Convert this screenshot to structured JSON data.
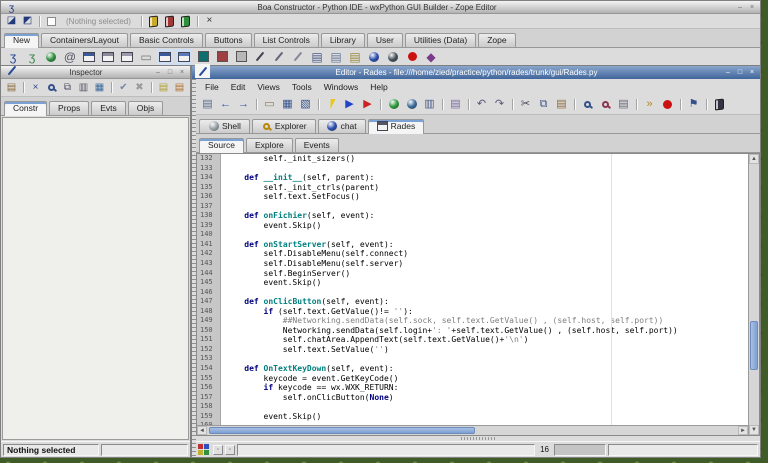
{
  "colors": {
    "desktop_green": "#3f5c28",
    "editor_titlebar_blue": "#40669b",
    "scrollbar_thumb_blue": "#7d9fd2",
    "selected_tab_accent": "#7ba2d4",
    "code_keyword": "#00007f",
    "code_function_name": "#007f7f",
    "code_string": "#7f7f7f",
    "code_comment": "#7f7f7f"
  },
  "main_window": {
    "title": "Boa Constructor - Python IDE - wxPython GUI Builder - Zope Editor",
    "title_icon": [
      {
        "name": "boa-logo-icon",
        "type": "glyph",
        "glyph": "ʒ",
        "color": "#16308a",
        "static": true
      }
    ],
    "window_buttons": [
      {
        "name": "minimize-button",
        "glyph": "–"
      },
      {
        "name": "close-button",
        "glyph": "×"
      }
    ],
    "toolbar": {
      "left_icons": [
        {
          "name": "frame-designer-icon",
          "type": "glyph",
          "glyph": "◪",
          "color": "#223a7a"
        },
        {
          "name": "data-view-icon",
          "type": "glyph",
          "glyph": "◩",
          "color": "#223a7a"
        },
        {
          "type": "sep"
        },
        {
          "name": "post-on-close-checkbox",
          "type": "checkbox"
        }
      ],
      "selection_label": "(Nothing selected)",
      "right_icons": [
        {
          "type": "sep"
        },
        {
          "name": "help-book-yellow-icon",
          "type": "book",
          "color": "#c8aa28"
        },
        {
          "name": "help-book-red-icon",
          "type": "book",
          "color": "#a03838"
        },
        {
          "name": "help-book-green-icon",
          "type": "book",
          "color": "#2f8f3f"
        },
        {
          "type": "sep"
        },
        {
          "name": "close-view-icon",
          "type": "glyph",
          "glyph": "×",
          "color": "#333333"
        }
      ]
    },
    "palette_tabs": [
      "New",
      "Containers/Layout",
      "Basic Controls",
      "Buttons",
      "List Controls",
      "Library",
      "User",
      "Utilities (Data)",
      "Zope"
    ],
    "selected_palette_tab": "New",
    "palette_icons": [
      {
        "name": "boa-app-icon",
        "type": "glyph",
        "glyph": "ʒ",
        "color": "#1a3a8c"
      },
      {
        "name": "green-snake-icon",
        "type": "glyph",
        "glyph": "ʒ",
        "color": "#2f7f3f"
      },
      {
        "name": "green-globe-icon",
        "type": "ball",
        "color": "#2f8f3f"
      },
      {
        "name": "at-symbol-icon",
        "type": "glyph",
        "glyph": "@",
        "color": "#555566"
      },
      {
        "name": "wx-frame-icon",
        "type": "window",
        "color": "#3a5a9c"
      },
      {
        "name": "wx-dialog-icon",
        "type": "window",
        "color": "#8a8a9a"
      },
      {
        "name": "wx-mini-frame-icon",
        "type": "window",
        "color": "#9a9aaa"
      },
      {
        "name": "wx-panel-icon",
        "type": "glyph",
        "glyph": "▭",
        "color": "#777777"
      },
      {
        "name": "wx-mdi-parent-frame-icon",
        "type": "window",
        "color": "#3a5a9c",
        "bg": "#cfe0f4"
      },
      {
        "name": "wx-mdi-child-frame-icon",
        "type": "window",
        "color": "#5a7abc",
        "bg": "#cfe0f4"
      },
      {
        "name": "teal-module-icon",
        "type": "square",
        "color": "#0f6f6f"
      },
      {
        "name": "red-module-icon",
        "type": "square",
        "color": "#9f3f3f"
      },
      {
        "name": "gray-module-icon",
        "type": "square",
        "color": "#b8b8b8"
      },
      {
        "name": "stylus-tool-icon-1",
        "type": "pen",
        "color": "#444455"
      },
      {
        "name": "stylus-tool-icon-2",
        "type": "pen",
        "color": "#666677"
      },
      {
        "name": "stylus-tool-icon-3",
        "type": "pen",
        "color": "#888899"
      },
      {
        "name": "text-document-icon-1",
        "type": "glyph",
        "glyph": "▤",
        "color": "#4a5a8a"
      },
      {
        "name": "text-document-icon-2",
        "type": "glyph",
        "glyph": "▤",
        "color": "#6a7a9a"
      },
      {
        "name": "text-document-icon-3",
        "type": "glyph",
        "glyph": "▤",
        "color": "#9a8a3a"
      },
      {
        "name": "blue-globe-doc-icon",
        "type": "ball",
        "color": "#2a4faf"
      },
      {
        "name": "dark-globe-doc-icon",
        "type": "ball",
        "color": "#44505a"
      },
      {
        "name": "red-dot-icon",
        "type": "dot",
        "color": "#cc1111"
      },
      {
        "name": "image-editor-icon",
        "type": "glyph",
        "glyph": "◆",
        "color": "#7a3a8a"
      }
    ]
  },
  "inspector": {
    "title": "Inspector",
    "title_icon": [
      {
        "name": "inspector-tool-icon",
        "type": "pen",
        "color": "#2a4a9a",
        "static": true
      }
    ],
    "window_buttons": [
      {
        "name": "minimize-button",
        "glyph": "–"
      },
      {
        "name": "maximize-button",
        "glyph": "□"
      },
      {
        "name": "close-button",
        "glyph": "×"
      }
    ],
    "toolbar_icons": [
      {
        "name": "paste-style-icon",
        "type": "glyph",
        "glyph": "▤",
        "color": "#8c6a3a"
      },
      {
        "type": "sep"
      },
      {
        "name": "delete-item-icon",
        "type": "glyph",
        "glyph": "×",
        "color": "#33508c"
      },
      {
        "name": "find-item-icon",
        "type": "mag",
        "color": "#33508c"
      },
      {
        "name": "copy-item-icon",
        "type": "glyph",
        "glyph": "⧉",
        "color": "#555566"
      },
      {
        "name": "paste-item-icon",
        "type": "glyph",
        "glyph": "▥",
        "color": "#555566"
      },
      {
        "name": "notebook-icon",
        "type": "glyph",
        "glyph": "▦",
        "color": "#3a6a9a"
      },
      {
        "type": "sep"
      },
      {
        "name": "post-changes-icon",
        "type": "glyph",
        "glyph": "✔",
        "color": "#7788aa"
      },
      {
        "name": "cancel-changes-icon",
        "type": "glyph",
        "glyph": "✖",
        "color": "#999999"
      },
      {
        "type": "sep"
      },
      {
        "name": "add-page-icon",
        "type": "glyph",
        "glyph": "▤",
        "color": "#b0a030"
      },
      {
        "name": "remove-page-icon",
        "type": "glyph",
        "glyph": "▤",
        "color": "#b07030"
      }
    ],
    "tabs": [
      "Constr",
      "Props",
      "Evts",
      "Objs"
    ],
    "selected_tab": "Constr",
    "status": "Nothing selected"
  },
  "editor": {
    "title": "Editor - Rades - file:///home/zied/practice/python/rades/trunk/gui/Rades.py",
    "title_icon": [
      {
        "name": "editor-app-icon",
        "type": "pen",
        "color": "#2a4a9a",
        "bg": "#f5f5f5",
        "static": true
      }
    ],
    "window_buttons": [
      {
        "name": "minimize-button",
        "glyph": "–"
      },
      {
        "name": "maximize-button",
        "glyph": "□"
      },
      {
        "name": "close-button",
        "glyph": "×"
      }
    ],
    "menus": [
      "File",
      "Edit",
      "Views",
      "Tools",
      "Windows",
      "Help"
    ],
    "toolbar_icons": [
      {
        "name": "open-module-icon",
        "type": "glyph",
        "glyph": "▤",
        "color": "#5a6b8c"
      },
      {
        "name": "history-back-icon",
        "type": "glyph",
        "glyph": "←",
        "color": "#3355aa"
      },
      {
        "name": "history-forward-icon",
        "type": "glyph",
        "glyph": "→",
        "color": "#3355aa"
      },
      {
        "type": "sep"
      },
      {
        "name": "open-icon",
        "type": "glyph",
        "glyph": "▭",
        "color": "#8a7a4a"
      },
      {
        "name": "save-icon",
        "type": "glyph",
        "glyph": "▦",
        "color": "#33508c"
      },
      {
        "name": "save-as-icon",
        "type": "glyph",
        "glyph": "▧",
        "color": "#33508c"
      },
      {
        "type": "sep"
      },
      {
        "name": "run-application-icon",
        "type": "bolt"
      },
      {
        "name": "run-module-icon",
        "type": "glyph",
        "glyph": "▶",
        "color": "#2244cc"
      },
      {
        "name": "debug-icon",
        "type": "glyph",
        "glyph": "▶",
        "color": "#cc2222"
      },
      {
        "type": "sep"
      },
      {
        "name": "check-source-icon",
        "type": "ball",
        "color": "#2a9a3a"
      },
      {
        "name": "profile-icon",
        "type": "ball",
        "color": "#3a6a9a"
      },
      {
        "name": "cyclops-report-icon",
        "type": "glyph",
        "glyph": "▥",
        "color": "#4a5a8a"
      },
      {
        "type": "sep"
      },
      {
        "name": "todo-icon",
        "type": "glyph",
        "glyph": "▤",
        "color": "#7a6aa0"
      },
      {
        "type": "sep"
      },
      {
        "name": "undo-icon",
        "type": "glyph",
        "glyph": "↶",
        "color": "#555577"
      },
      {
        "name": "redo-icon",
        "type": "glyph",
        "glyph": "↷",
        "color": "#555577"
      },
      {
        "type": "sep"
      },
      {
        "name": "cut-icon",
        "type": "glyph",
        "glyph": "✂",
        "color": "#444455"
      },
      {
        "name": "copy-icon",
        "type": "glyph",
        "glyph": "⧉",
        "color": "#445a8c"
      },
      {
        "name": "paste-icon",
        "type": "glyph",
        "glyph": "▤",
        "color": "#8c6a3a"
      },
      {
        "type": "sep"
      },
      {
        "name": "find-icon",
        "type": "mag",
        "color": "#33508c"
      },
      {
        "name": "find-again-icon",
        "type": "mag",
        "color": "#8c3350"
      },
      {
        "name": "print-icon",
        "type": "glyph",
        "glyph": "▤",
        "color": "#666677"
      },
      {
        "type": "sep"
      },
      {
        "name": "goto-line-icon",
        "type": "glyph",
        "glyph": "»",
        "color": "#b08a20"
      },
      {
        "name": "breakpoint-icon",
        "type": "dot",
        "color": "#cc1111"
      },
      {
        "type": "sep"
      },
      {
        "name": "flags-icon",
        "type": "glyph",
        "glyph": "⚑",
        "color": "#33508c"
      },
      {
        "type": "sep"
      },
      {
        "name": "help-book-icon",
        "type": "book",
        "color": "#333344"
      }
    ],
    "tabs": [
      {
        "label": "Shell",
        "icon": {
          "name": "shell-tab-icon",
          "type": "ball",
          "color": "#99a5aa",
          "static": true
        }
      },
      {
        "label": "Explorer",
        "icon": {
          "name": "explorer-tab-icon",
          "type": "mag",
          "color": "#b8860b",
          "static": true
        }
      },
      {
        "label": "chat",
        "icon": {
          "name": "chat-tab-icon",
          "type": "ball",
          "color": "#2b4fb0",
          "static": true
        }
      },
      {
        "label": "Rades",
        "icon": {
          "name": "rades-tab-icon",
          "type": "window",
          "color": "#555566",
          "static": true
        }
      }
    ],
    "selected_tab": "Rades",
    "subtabs": [
      "Source",
      "Explore",
      "Events"
    ],
    "selected_subtab": "Source",
    "status": {
      "line_indicator": "16",
      "grid_colors": [
        "#c03030",
        "#3050c0",
        "#c0b030",
        "#309040"
      ]
    },
    "code": {
      "first_line": 132,
      "lines": [
        [
          [
            "p",
            "        self._init_sizers()"
          ]
        ],
        [],
        [
          [
            "p",
            "    "
          ],
          [
            "k",
            "def"
          ],
          [
            "p",
            " "
          ],
          [
            "f",
            "__init__"
          ],
          [
            "p",
            "(self, parent):"
          ]
        ],
        [
          [
            "p",
            "        self._init_ctrls(parent)"
          ]
        ],
        [
          [
            "p",
            "        self.text.SetFocus()"
          ]
        ],
        [],
        [
          [
            "p",
            "    "
          ],
          [
            "k",
            "def"
          ],
          [
            "p",
            " "
          ],
          [
            "f",
            "onFichier"
          ],
          [
            "p",
            "(self, event):"
          ]
        ],
        [
          [
            "p",
            "        event.Skip()"
          ]
        ],
        [],
        [
          [
            "p",
            "    "
          ],
          [
            "k",
            "def"
          ],
          [
            "p",
            " "
          ],
          [
            "f",
            "onStartServer"
          ],
          [
            "p",
            "(self, event):"
          ]
        ],
        [
          [
            "p",
            "        self.DisableMenu(self.connect)"
          ]
        ],
        [
          [
            "p",
            "        self.DisableMenu(self.server)"
          ]
        ],
        [
          [
            "p",
            "        self.BeginServer()"
          ]
        ],
        [
          [
            "p",
            "        event.Skip()"
          ]
        ],
        [],
        [
          [
            "p",
            "    "
          ],
          [
            "k",
            "def"
          ],
          [
            "p",
            " "
          ],
          [
            "f",
            "onClicButton"
          ],
          [
            "p",
            "(self, event):"
          ]
        ],
        [
          [
            "p",
            "        "
          ],
          [
            "k",
            "if"
          ],
          [
            "p",
            " (self.text.GetValue()!= "
          ],
          [
            "s",
            "''"
          ],
          [
            "p",
            "):"
          ]
        ],
        [
          [
            "c",
            "            ##Networking.sendData(self.sock, self.text.GetValue() , (self.host, self.port))"
          ]
        ],
        [
          [
            "p",
            "            Networking.sendData(self.login+"
          ],
          [
            "s",
            "': '"
          ],
          [
            "p",
            "+self.text.GetValue() , (self.host, self.port))"
          ]
        ],
        [
          [
            "p",
            "            self.chatArea.AppendText(self.text.GetValue()+"
          ],
          [
            "s",
            "'\\n'"
          ],
          [
            "p",
            ")"
          ]
        ],
        [
          [
            "p",
            "            self.text.SetValue("
          ],
          [
            "s",
            "''"
          ],
          [
            "p",
            ")"
          ]
        ],
        [],
        [
          [
            "p",
            "    "
          ],
          [
            "k",
            "def"
          ],
          [
            "p",
            " "
          ],
          [
            "f",
            "OnTextKeyDown"
          ],
          [
            "p",
            "(self, event):"
          ]
        ],
        [
          [
            "p",
            "        keycode = event.GetKeyCode()"
          ]
        ],
        [
          [
            "p",
            "        "
          ],
          [
            "k",
            "if"
          ],
          [
            "p",
            " keycode == wx.WXK_RETURN:"
          ]
        ],
        [
          [
            "p",
            "            self.onClicButton("
          ],
          [
            "k",
            "None"
          ],
          [
            "p",
            ")"
          ]
        ],
        [],
        [
          [
            "p",
            "        event.Skip()"
          ]
        ],
        []
      ]
    }
  }
}
